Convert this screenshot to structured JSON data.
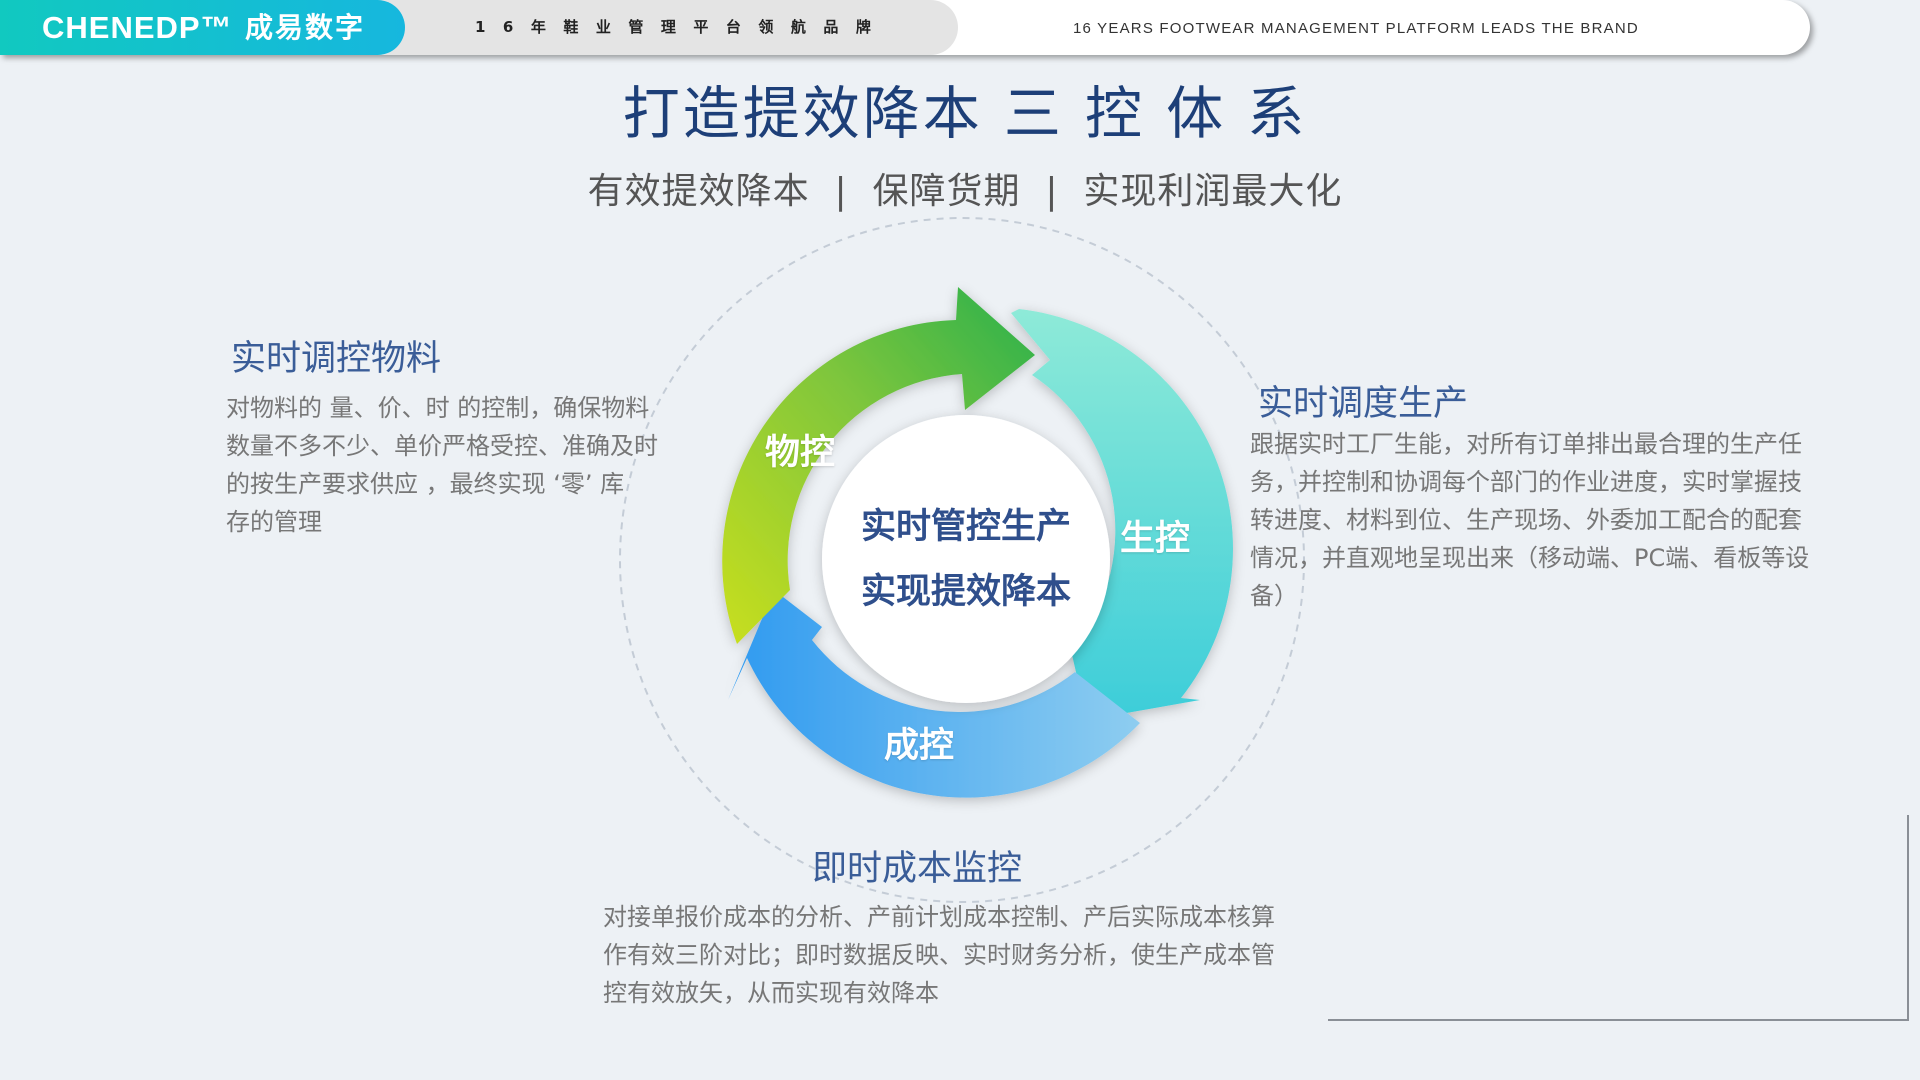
{
  "header": {
    "brand": "CHENEDP™",
    "brand_cn": "成易数字",
    "slogan_cn": "16年鞋业管理平台领航品牌",
    "slogan_en": "16 YEARS FOOTWEAR MANAGEMENT PLATFORM LEADS THE BRAND"
  },
  "title": "打造提效降本 三 控 体 系",
  "subtitle": "有效提效降本  |  保障货期  |  实现利润最大化",
  "center": {
    "line1": "实时管控生产",
    "line2": "实现提效降本"
  },
  "segments": {
    "material": "物控",
    "production": "生控",
    "cost": "成控"
  },
  "sections": {
    "material": {
      "title": "实时调控物料",
      "lines": [
        "对物料的 量、价、时 的控制，确保物料",
        "数量不多不少、单价严格受控、准确及时",
        "的按生产要求供应 ，最终实现 ‘零’ 库",
        "存的管理"
      ]
    },
    "production": {
      "title": "实时调度生产",
      "lines": [
        "跟据实时工厂生能，对所有订单排出最合理的生产任",
        "务，并控制和协调每个部门的作业进度，实时掌握技",
        "转进度、材料到位、生产现场、外委加工配合的配套",
        "情况，并直观地呈现出来（移动端、PC端、看板等设",
        "备）"
      ]
    },
    "cost": {
      "title": "即时成本监控",
      "lines": [
        "对接单报价成本的分析、产前计划成本控制、产后实际成本核算",
        "作有效三阶对比；即时数据反映、实时财务分析，使生产成本管",
        "控有效放矢，从而实现有效降本"
      ]
    }
  },
  "colors": {
    "title": "#1d3f78",
    "section_title": "#3a5d98",
    "green_arrow": "#3db54a",
    "teal_arrow": "#45cfd5",
    "blue_arrow": "#3aa4ee",
    "logo": "#16b7de"
  }
}
